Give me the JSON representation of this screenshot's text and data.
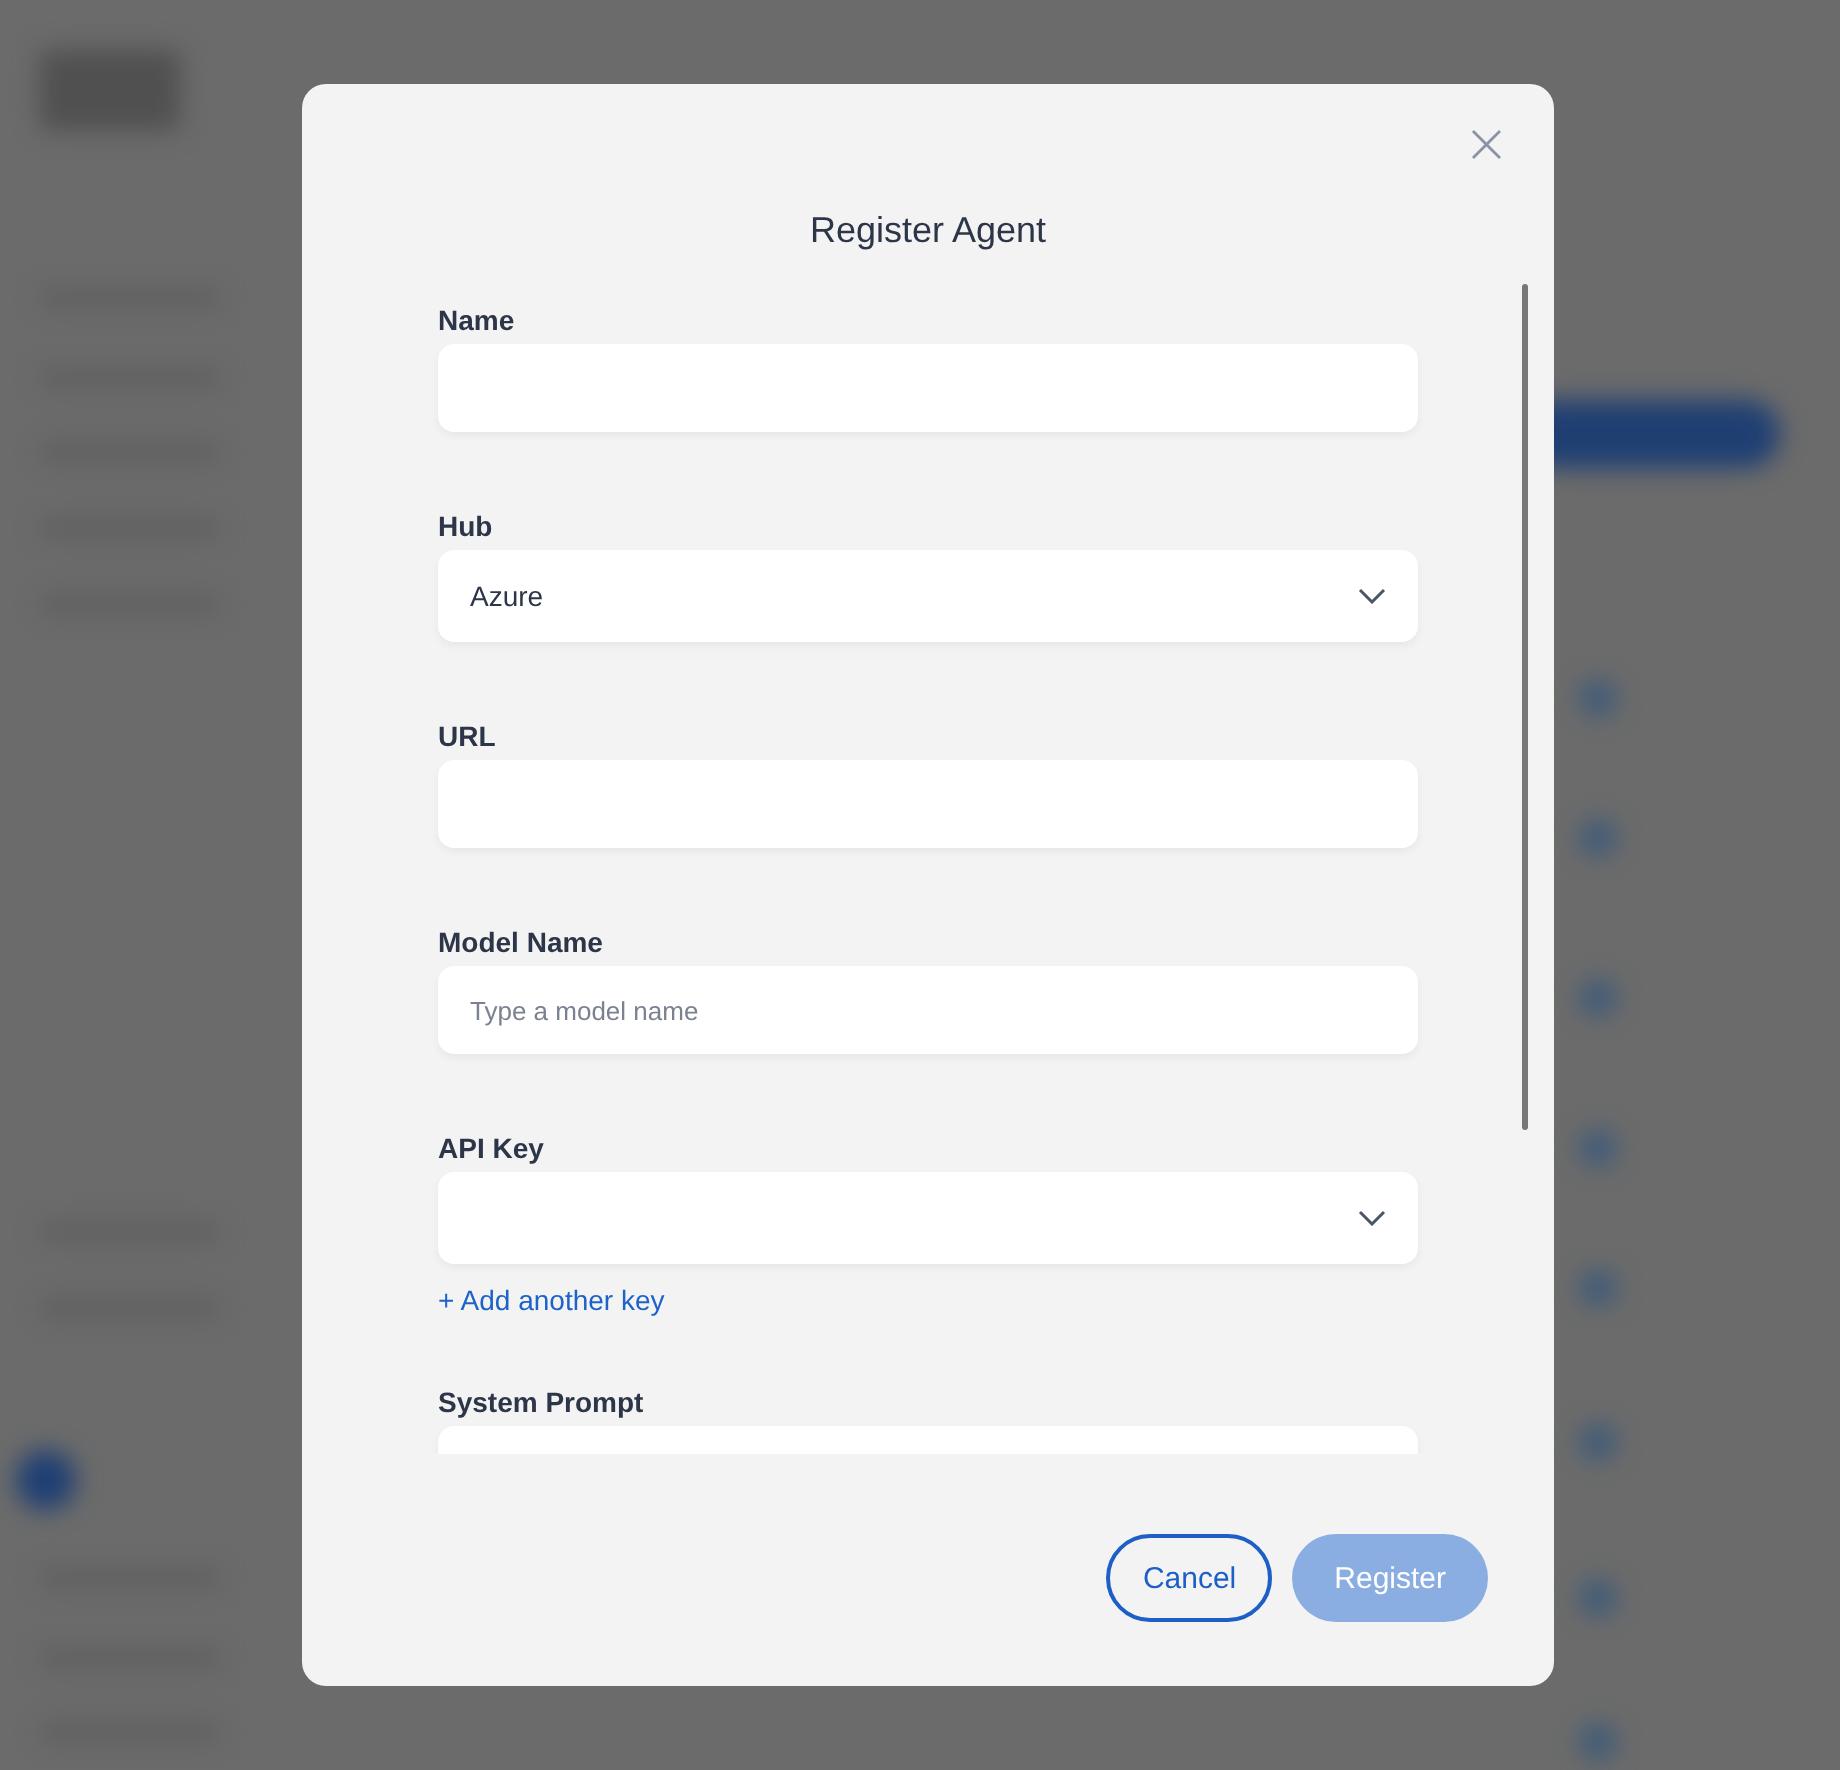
{
  "dialog": {
    "title": "Register Agent",
    "close": "×",
    "fields": [
      {
        "kind": "text",
        "label": "Name"
      },
      {
        "kind": "select",
        "label": "Hub",
        "value": "Azure"
      },
      {
        "kind": "text",
        "label": "URL"
      },
      {
        "kind": "text",
        "label": "Model Name",
        "placeholder": "Type a model name"
      },
      {
        "kind": "select",
        "label": "API Key",
        "link": "+ Add another key"
      },
      {
        "kind": "textarea",
        "label": "System Prompt"
      }
    ],
    "buttons": [
      {
        "kind": "secondary",
        "label": "Cancel",
        "disabled": false
      },
      {
        "kind": "primary",
        "label": "Register",
        "disabled": true
      }
    ]
  }
}
